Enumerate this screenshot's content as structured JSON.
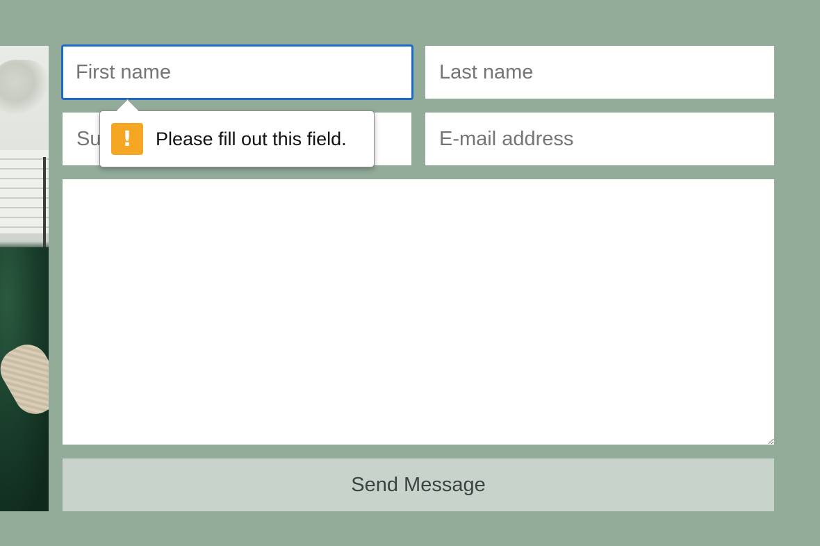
{
  "form": {
    "first_name": {
      "placeholder": "First name",
      "value": ""
    },
    "last_name": {
      "placeholder": "Last name",
      "value": ""
    },
    "subject": {
      "placeholder": "Subject",
      "value": ""
    },
    "email": {
      "placeholder": "E-mail address",
      "value": ""
    },
    "message": {
      "placeholder": "",
      "value": ""
    },
    "send_label": "Send Message"
  },
  "validation": {
    "message": "Please fill out this field.",
    "icon": "warning-icon",
    "icon_glyph": "!"
  },
  "colors": {
    "background": "#93ac9a",
    "focus_ring": "#1a6bc8",
    "warning": "#f5a623",
    "button_bg": "#c8d3cb"
  }
}
